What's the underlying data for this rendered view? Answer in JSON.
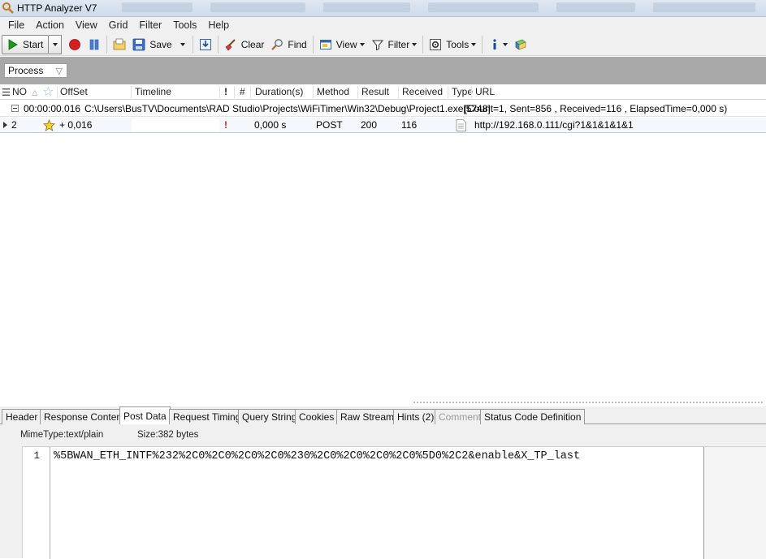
{
  "window": {
    "title": "HTTP Analyzer V7"
  },
  "menu": [
    "File",
    "Action",
    "View",
    "Grid",
    "Filter",
    "Tools",
    "Help"
  ],
  "toolbar": {
    "start_label": "Start",
    "save_label": "Save",
    "clear_label": "Clear",
    "find_label": "Find",
    "view_label": "View",
    "filter_label": "Filter",
    "tools_label": "Tools"
  },
  "filter": {
    "process_label": "Process"
  },
  "grid": {
    "columns": {
      "no": "NO",
      "offset": "OffSet",
      "timeline": "Timeline",
      "flag": "!",
      "hash": "#",
      "duration": "Duration(s)",
      "method": "Method",
      "result": "Result",
      "received": "Received",
      "type": "Type",
      "url": "URL"
    },
    "group": {
      "time": "00:00:00.016",
      "path": "C:\\Users\\BusTV\\Documents\\RAD Studio\\Projects\\WiFiTimer\\Win32\\Debug\\Project1.exe[5748]",
      "stats": "(Count=1, Sent=856 , Received=116 , ElapsedTime=0,000 s)"
    },
    "rows": [
      {
        "no": "2",
        "offset": "+ 0,016",
        "flag": "!",
        "duration": "0,000 s",
        "method": "POST",
        "result": "200",
        "received": "116",
        "url": "http://192.168.0.111/cgi?1&1&1&1&1"
      }
    ]
  },
  "tabs": [
    {
      "label": "Header",
      "active": false,
      "disabled": false
    },
    {
      "label": "Response Content",
      "active": false,
      "disabled": false
    },
    {
      "label": "Post Data",
      "active": true,
      "disabled": false
    },
    {
      "label": "Request Timing",
      "active": false,
      "disabled": false
    },
    {
      "label": "Query String",
      "active": false,
      "disabled": false
    },
    {
      "label": "Cookies",
      "active": false,
      "disabled": false
    },
    {
      "label": "Raw Stream",
      "active": false,
      "disabled": false
    },
    {
      "label": "Hints (2)",
      "active": false,
      "disabled": false
    },
    {
      "label": "Comment",
      "active": false,
      "disabled": true
    },
    {
      "label": "Status Code Definition",
      "active": false,
      "disabled": false
    }
  ],
  "post_data": {
    "mime": "MimeType:text/plain",
    "size": "Size:382 bytes",
    "line_number": "1",
    "content": "%5BWAN_ETH_INTF%232%2C0%2C0%2C0%2C0%230%2C0%2C0%2C0%2C0%5D0%2C2&enable&X_TP_last"
  },
  "colors": {
    "accent_red": "#d42020",
    "start_green": "#1a9a1a",
    "filter_bar": "#a8a8a8"
  }
}
